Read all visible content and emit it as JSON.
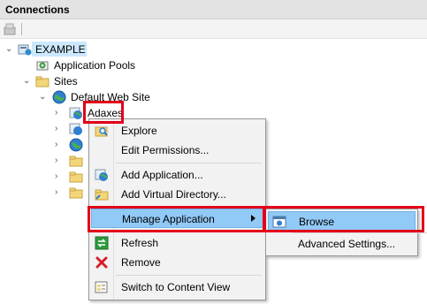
{
  "panel": {
    "title": "Connections"
  },
  "tree": {
    "root": "EXAMPLE",
    "app_pools": "Application Pools",
    "sites": "Sites",
    "default_site": "Default Web Site",
    "adaxes": "Adaxes"
  },
  "context_menu": {
    "explore": "Explore",
    "edit_permissions": "Edit Permissions...",
    "add_application": "Add Application...",
    "add_virtual_directory": "Add Virtual Directory...",
    "manage_application": "Manage Application",
    "refresh": "Refresh",
    "remove": "Remove",
    "switch_content_view": "Switch to Content View"
  },
  "submenu": {
    "browse": "Browse",
    "advanced_settings": "Advanced Settings..."
  },
  "colors": {
    "highlight_border": "#e2001a",
    "selection": "#91c9f7"
  }
}
